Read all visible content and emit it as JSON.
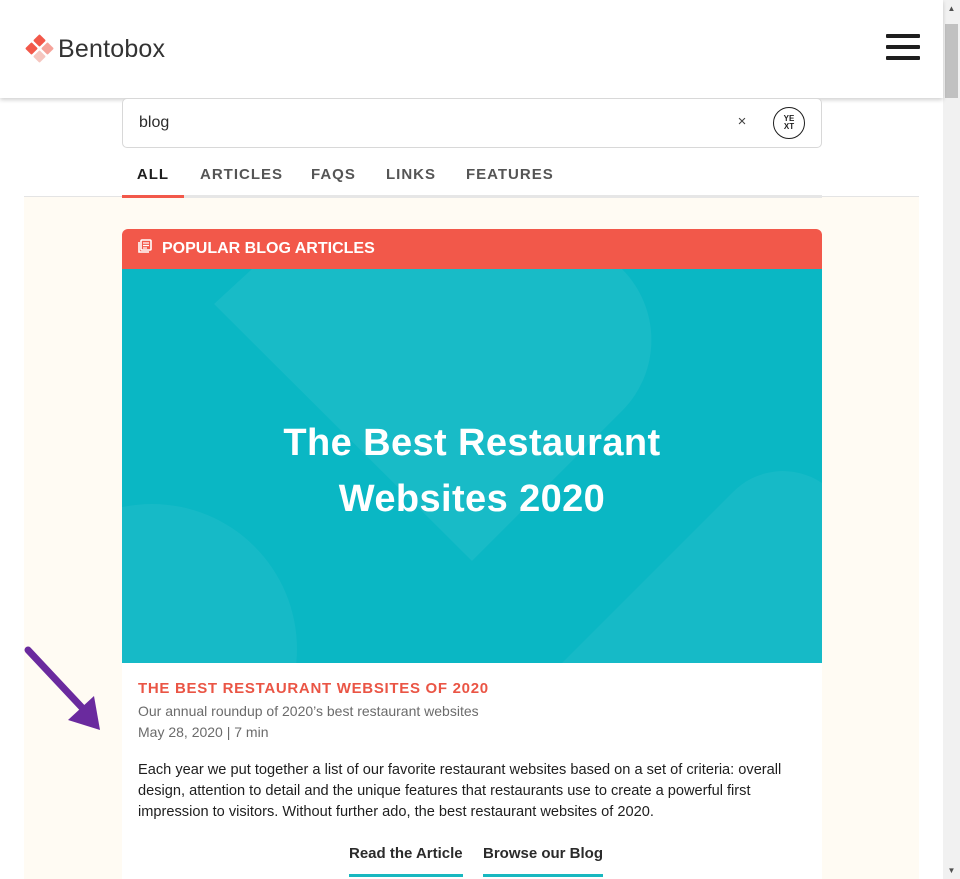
{
  "header": {
    "brand": "Bentobox",
    "colors": {
      "brand_red": "#f2584a",
      "brand_light": "#f5a39a"
    }
  },
  "search": {
    "value": "blog",
    "clear_label": "×",
    "provider_badge_line1": "YE",
    "provider_badge_line2": "XT"
  },
  "tabs": [
    {
      "label": "ALL",
      "active": true
    },
    {
      "label": "ARTICLES",
      "active": false
    },
    {
      "label": "FAQS",
      "active": false
    },
    {
      "label": "LINKS",
      "active": false
    },
    {
      "label": "FEATURES",
      "active": false
    }
  ],
  "section": {
    "title": "POPULAR BLOG ARTICLES",
    "icon": "articles-icon",
    "accent_color": "#f2584a"
  },
  "article": {
    "hero_line1": "The Best Restaurant",
    "hero_line2": "Websites 2020",
    "hero_color": "#0ab7c4",
    "title": "THE BEST RESTAURANT WEBSITES OF 2020",
    "subtitle": "Our annual roundup of 2020’s best restaurant websites",
    "meta": "May 28, 2020 | 7 min",
    "body": "Each year we put together a list of our favorite restaurant websites based on a set of criteria: overall design, attention to detail and the unique features that restaurants use to create a powerful first impression to visitors. Without further ado, the best restaurant websites of 2020.",
    "cta_read": "Read the Article",
    "cta_browse": "Browse our Blog"
  },
  "annotation": {
    "icon": "arrow-icon",
    "color": "#6a2a9e"
  }
}
